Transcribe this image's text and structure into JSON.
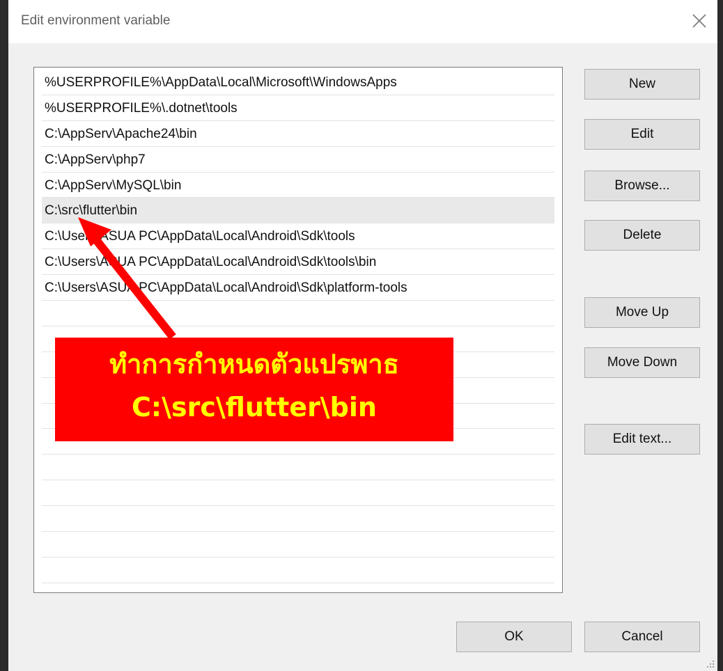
{
  "window": {
    "title": "Edit environment variable",
    "close_icon": "close-icon"
  },
  "list": {
    "items": [
      "%USERPROFILE%\\AppData\\Local\\Microsoft\\WindowsApps",
      "%USERPROFILE%\\.dotnet\\tools",
      "C:\\AppServ\\Apache24\\bin",
      "C:\\AppServ\\php7",
      "C:\\AppServ\\MySQL\\bin",
      "C:\\src\\flutter\\bin",
      "C:\\Users\\ASUA PC\\AppData\\Local\\Android\\Sdk\\tools",
      "C:\\Users\\ASUA PC\\AppData\\Local\\Android\\Sdk\\tools\\bin",
      "C:\\Users\\ASUA PC\\AppData\\Local\\Android\\Sdk\\platform-tools",
      "",
      "",
      "",
      "",
      "",
      "",
      "",
      "",
      "",
      "",
      ""
    ],
    "selected_index": 5
  },
  "buttons": {
    "new": "New",
    "edit": "Edit",
    "browse": "Browse...",
    "delete": "Delete",
    "move_up": "Move Up",
    "move_down": "Move Down",
    "edit_text": "Edit text...",
    "ok": "OK",
    "cancel": "Cancel"
  },
  "annotation": {
    "line1": "ทำการกำหนดตัวแปรพาธ",
    "line2": "C:\\src\\flutter\\bin",
    "box_color": "#ff0000",
    "text_color": "#ffff00"
  }
}
